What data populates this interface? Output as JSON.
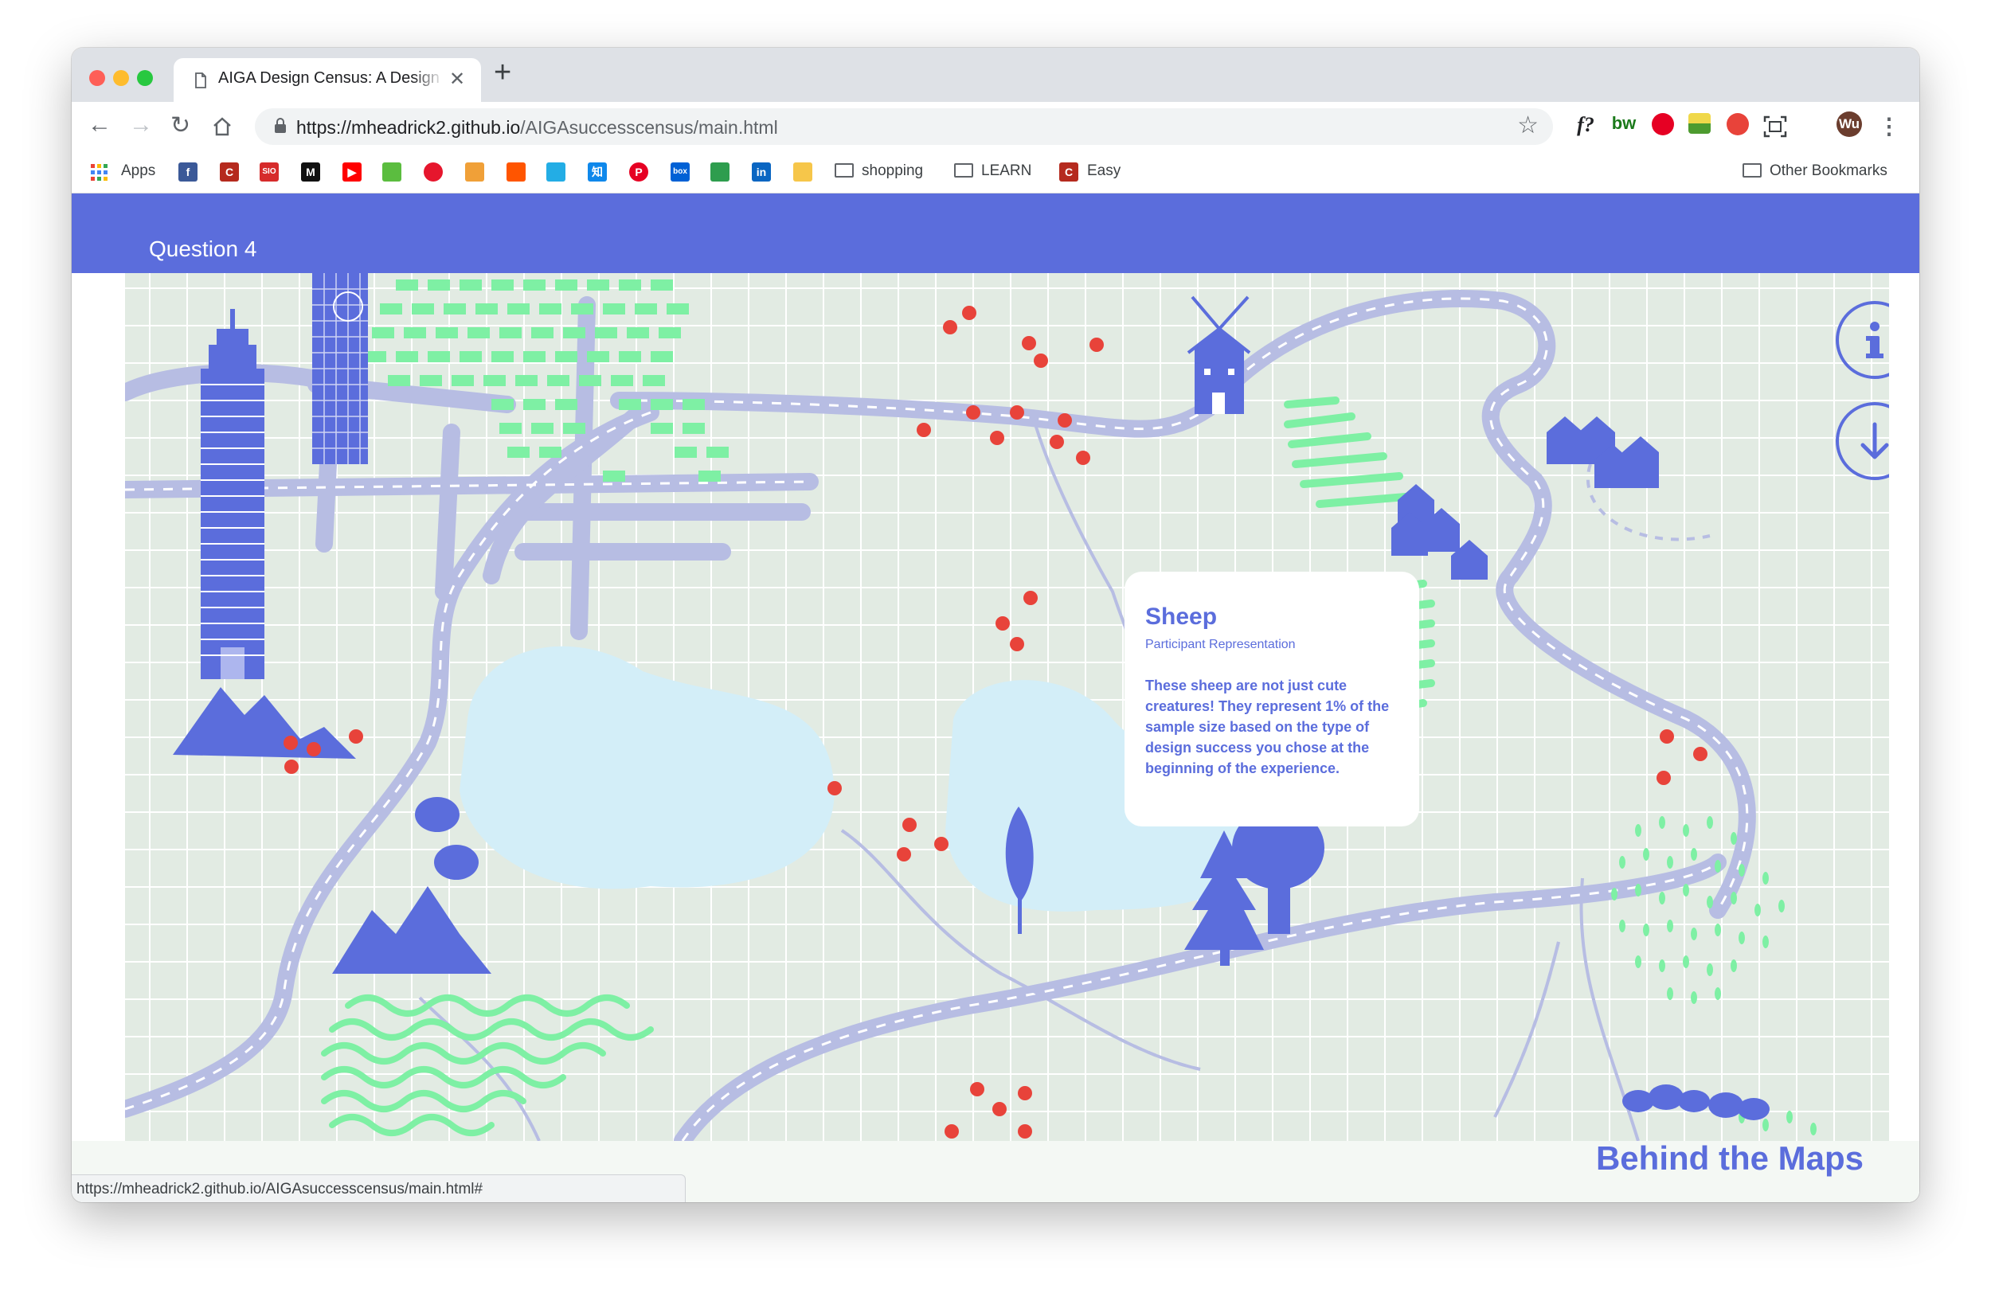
{
  "browser": {
    "tab_title": "AIGA Design Census: A Design Census Visualization",
    "url_host": "https://mheadrick2.github.io",
    "url_path": "/AIGAsuccesscensus/main.html",
    "profile_initials": "Wu",
    "status_url": "https://mheadrick2.github.io/AIGAsuccesscensus/main.html#",
    "extensions": [
      "f?",
      "bw"
    ],
    "bookmarks": {
      "apps": "Apps",
      "shopping": "shopping",
      "learn": "LEARN",
      "easy": "Easy",
      "other": "Other Bookmarks"
    }
  },
  "page": {
    "question": "Question 4",
    "popup": {
      "title": "Sheep",
      "subtitle": "Participant Representation",
      "body": "These sheep are not just cute creatures! They represent 1% of the sample size based on the type of design success you chose at the beginning of the experience."
    },
    "footer_link": "Behind the Maps"
  },
  "colors": {
    "brand": "#5b6ddc",
    "map_bg": "#e2ebe3",
    "road": "#b7bde3",
    "water": "#d3eef8",
    "green": "#7ef0a4",
    "sheep": "#e8433a"
  }
}
